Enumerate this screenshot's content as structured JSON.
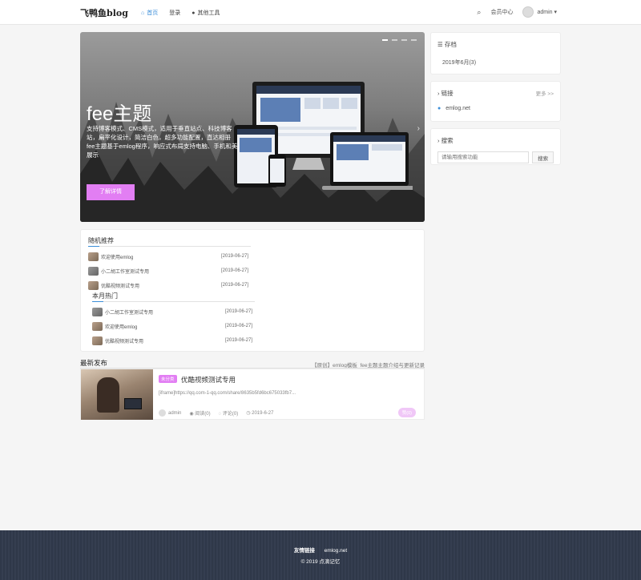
{
  "header": {
    "logo": "飞鸭鱼blog",
    "nav": [
      {
        "label": "首页",
        "icon": "home-icon"
      },
      {
        "label": "登录",
        "icon": ""
      },
      {
        "label": "其他工具",
        "icon": "user-icon"
      }
    ],
    "member_center": "会员中心",
    "user": "admin"
  },
  "hero": {
    "title": "fee主题",
    "desc_line1": "支持博客模式、CMS模式，适用于垂直站点、科技博客站，扁平化设计，简洁白色，超多功能配置，直达相册",
    "desc_line2": "fee主题基于emlog程序，响应式布局支持电脑、手机和美展示",
    "button": "了解详情",
    "slides": 4
  },
  "sidebar": {
    "archive": {
      "title": "存档",
      "items": [
        "2019年6月(3)"
      ]
    },
    "links": {
      "title": "链接",
      "more": "更多 >>",
      "items": [
        "emlog.net"
      ]
    },
    "search": {
      "title": "搜索",
      "placeholder": "请输用搜索功能",
      "button": "搜索"
    }
  },
  "random": {
    "title": "随机推荐",
    "items": [
      {
        "title": "欢迎使用emlog",
        "date": "[2019-06-27]"
      },
      {
        "title": "小二胡工作室测试专用",
        "date": "[2019-06-27]"
      },
      {
        "title": "优酷视频测试专用",
        "date": "[2019-06-27]"
      }
    ]
  },
  "hot": {
    "title": "本月热门",
    "items": [
      {
        "title": "小二胡工作室测试专用",
        "date": "[2019-06-27]"
      },
      {
        "title": "欢迎使用emlog",
        "date": "[2019-06-27]"
      },
      {
        "title": "优酷视频测试专用",
        "date": "[2019-06-27]"
      }
    ]
  },
  "latest": {
    "title": "最新发布",
    "notice": "【原创】emlog模板_fee主题主题介绍与更新记录",
    "post": {
      "category": "未分类",
      "title": "优酷视频测试专用",
      "excerpt": "[iframe]https://qq.com-1-qq.com/share/8635b5fd6bc675033fb7...",
      "author": "admin",
      "views": "阅读(0)",
      "comments": "评论(0)",
      "date": "2019-6-27",
      "like": "赞(0)"
    }
  },
  "footer": {
    "links_label": "友情链接",
    "link": "emlog.net",
    "copyright": "© 2019 点滴记忆"
  },
  "colors": {
    "accent": "#e27ef3",
    "link": "#3b8ed8",
    "footer": "#2f3849"
  }
}
